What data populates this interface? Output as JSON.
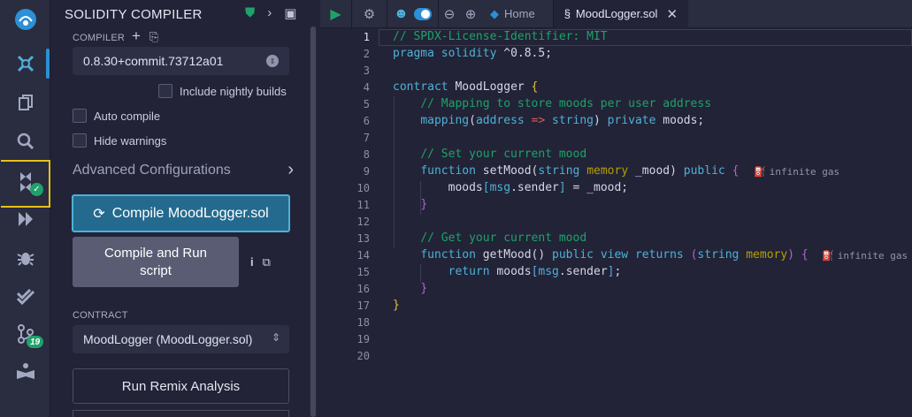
{
  "rail": {
    "icons": [
      "remix-logo-icon",
      "ai-icon",
      "files-icon",
      "search-icon",
      "solidity-compiler-icon",
      "deploy-icon",
      "debugger-icon",
      "testing-icon",
      "git-icon",
      "learn-icon"
    ],
    "git_badge": "19"
  },
  "panel": {
    "title": "SOLIDITY COMPILER",
    "compiler_label": "COMPILER",
    "compiler_version": "0.8.30+commit.73712a01",
    "include_nightly": "Include nightly builds",
    "auto_compile": "Auto compile",
    "hide_warnings": "Hide warnings",
    "advanced": "Advanced Configurations",
    "compile_button": "Compile MoodLogger.sol",
    "run_button": "Compile and Run script",
    "contract_label": "CONTRACT",
    "contract_value": "MoodLogger (MoodLogger.sol)",
    "analysis_button": "Run Remix Analysis"
  },
  "toolbar": {
    "home_tab": "Home",
    "file_tab": "MoodLogger.sol"
  },
  "editor": {
    "line_numbers": [
      "1",
      "2",
      "3",
      "4",
      "5",
      "6",
      "7",
      "8",
      "9",
      "10",
      "11",
      "12",
      "13",
      "14",
      "15",
      "16",
      "17",
      "18",
      "19",
      "20"
    ],
    "gas_label": "infinite gas"
  },
  "colors": {
    "accent": "#2d8fd5",
    "success": "#1ea26a",
    "highlight": "#e6c217"
  }
}
